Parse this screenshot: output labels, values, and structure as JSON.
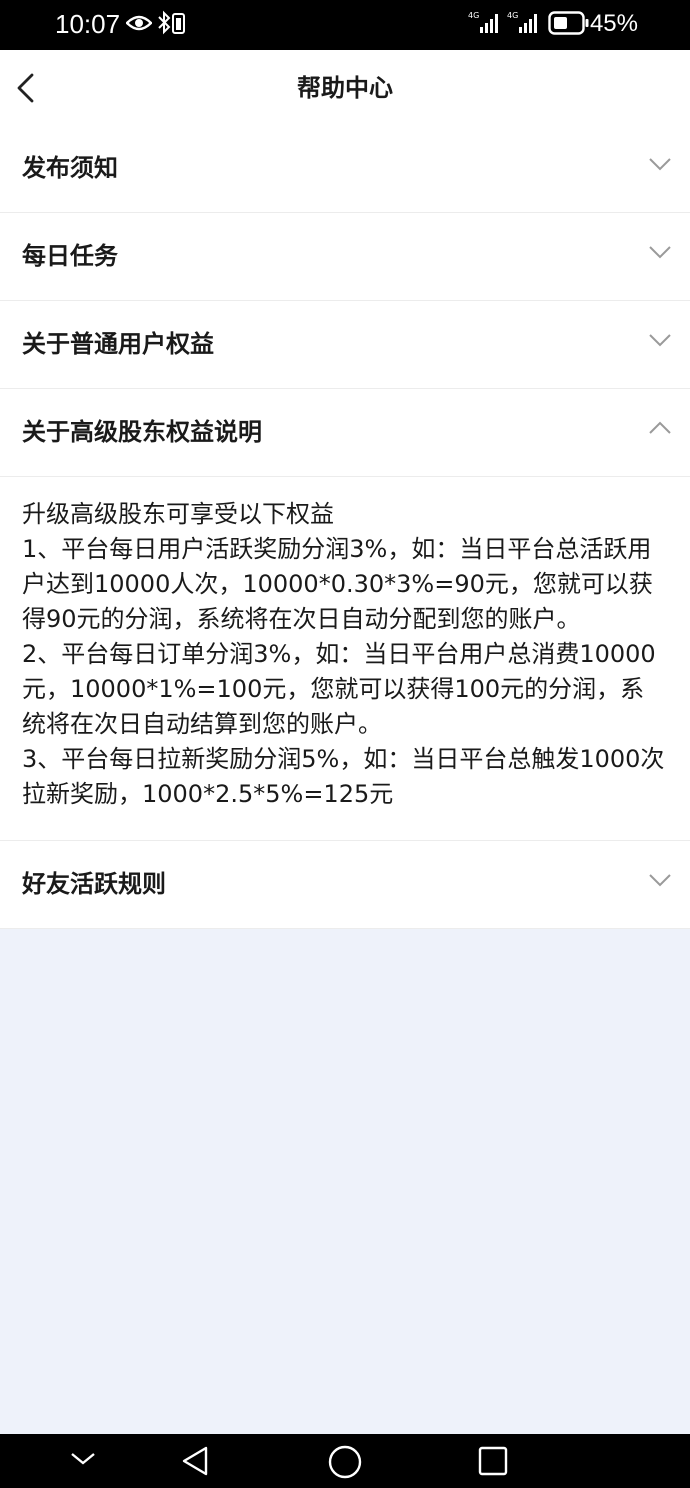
{
  "status_bar": {
    "time": "10:07",
    "battery": "45%"
  },
  "header": {
    "title": "帮助中心"
  },
  "sections": [
    {
      "title": "发布须知",
      "expanded": false
    },
    {
      "title": "每日任务",
      "expanded": false
    },
    {
      "title": "关于普通用户权益",
      "expanded": false
    },
    {
      "title": "关于高级股东权益说明",
      "expanded": true,
      "content": [
        "升级高级股东可享受以下权益",
        "1、平台每日用户活跃奖励分润3%，如：当日平台总活跃用户达到10000人次，10000*0.30*3%=90元，您就可以获得90元的分润，系统将在次日自动分配到您的账户。",
        "2、平台每日订单分润3%，如：当日平台用户总消费10000元，10000*1%=100元，您就可以获得100元的分润，系统将在次日自动结算到您的账户。",
        "3、平台每日拉新奖励分润5%，如：当日平台总触发1000次拉新奖励，1000*2.5*5%=125元"
      ]
    },
    {
      "title": "好友活跃规则",
      "expanded": false
    }
  ]
}
